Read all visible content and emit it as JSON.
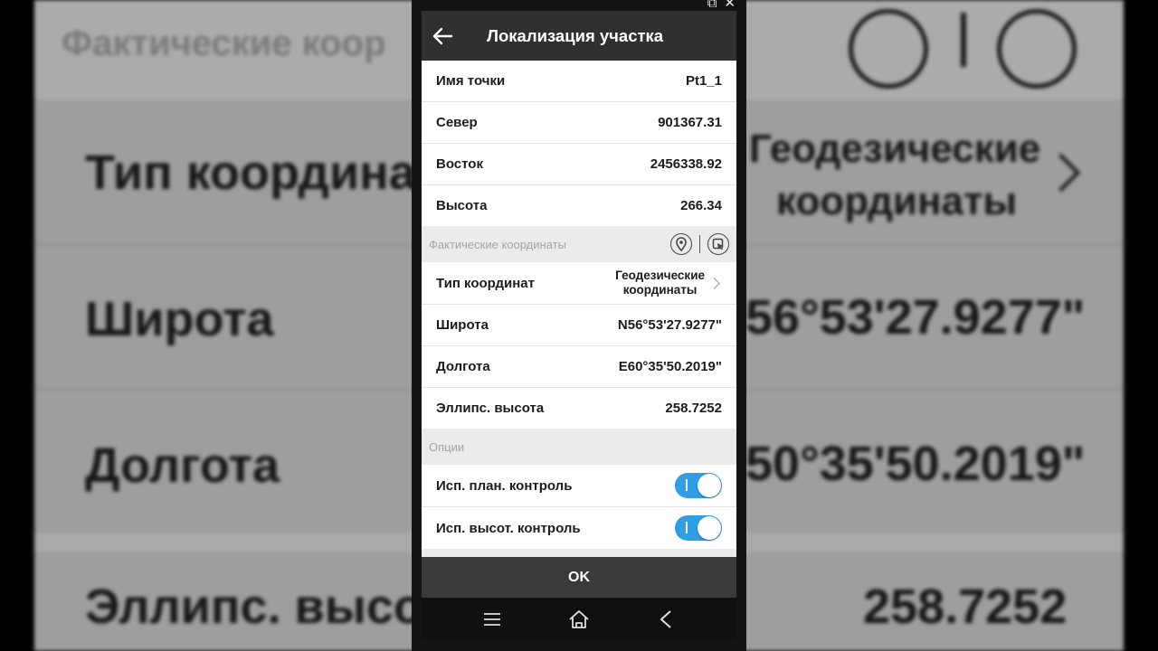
{
  "window": {
    "popout_icon": "⧉",
    "close_icon": "✕"
  },
  "background": {
    "header": "Фактические коор",
    "coord_type_label": "Тип координат",
    "coord_type_value_1": "Геодезические",
    "coord_type_value_2": "координаты",
    "latitude_label": "Широта",
    "latitude_value": "56°53'27.9277\"",
    "longitude_label": "Долгота",
    "longitude_value": "50°35'50.2019\"",
    "ellipse_label": "Эллипс. высот",
    "ellipse_value": "258.7252"
  },
  "appbar": {
    "title": "Локализация участка"
  },
  "point": [
    {
      "label": "Имя точки",
      "value": "Pt1_1"
    },
    {
      "label": "Север",
      "value": "901367.31"
    },
    {
      "label": "Восток",
      "value": "2456338.92"
    },
    {
      "label": "Высота",
      "value": "266.34"
    }
  ],
  "actual": {
    "section_title": "Фактические координаты",
    "coord_type_label": "Тип координат",
    "coord_type_value_1": "Геодезические",
    "coord_type_value_2": "координаты",
    "rows": [
      {
        "label": "Широта",
        "value": "N56°53'27.9277\""
      },
      {
        "label": "Долгота",
        "value": "E60°35'50.2019\""
      },
      {
        "label": "Эллипс. высота",
        "value": "258.7252"
      }
    ]
  },
  "options": {
    "section_title": "Опции",
    "toggles": [
      {
        "label": "Исп. план. контроль",
        "on": true
      },
      {
        "label": "Исп. высот. контроль",
        "on": true
      }
    ]
  },
  "ok_label": "OK",
  "colors": {
    "accent": "#2f9ee5",
    "appbar": "#303030",
    "okbar": "#3a3a3a"
  }
}
